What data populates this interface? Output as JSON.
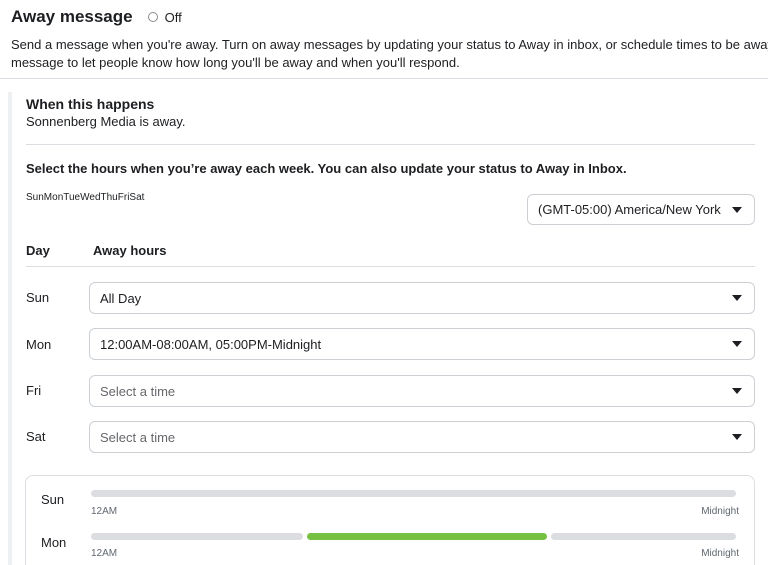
{
  "header": {
    "title": "Away message",
    "toggle_label": "Off"
  },
  "description": {
    "line1": "Send a message when you're away. Turn on away messages by updating your status to Away in inbox, or schedule times to be away",
    "line2": "message to let people know how long you'll be away and when you'll respond."
  },
  "trigger": {
    "title": "When this happens",
    "subtitle": "Sonnenberg Media is away."
  },
  "hours": {
    "title": "Select the hours when you’re away each week. You can also update your status to Away in Inbox.",
    "weekdays": [
      "Sun",
      "Mon",
      "Tue",
      "Wed",
      "Thu",
      "Fri",
      "Sat"
    ],
    "timezone": "(GMT-05:00) America/New York",
    "col_day": "Day",
    "col_hours": "Away hours",
    "rows": [
      {
        "day": "Sun",
        "value": "All Day",
        "placeholder": false
      },
      {
        "day": "Mon",
        "value": "12:00AM-08:00AM, 05:00PM-Midnight",
        "placeholder": false
      },
      {
        "day": "Fri",
        "value": "Select a time",
        "placeholder": true
      },
      {
        "day": "Sat",
        "value": "Select a time",
        "placeholder": true
      }
    ]
  },
  "schedule": {
    "start_label": "12AM",
    "end_label": "Midnight",
    "days": [
      {
        "day": "Sun"
      },
      {
        "day": "Mon"
      }
    ]
  },
  "colors": {
    "active": "#76c043",
    "inactive": "#dcdde0"
  }
}
